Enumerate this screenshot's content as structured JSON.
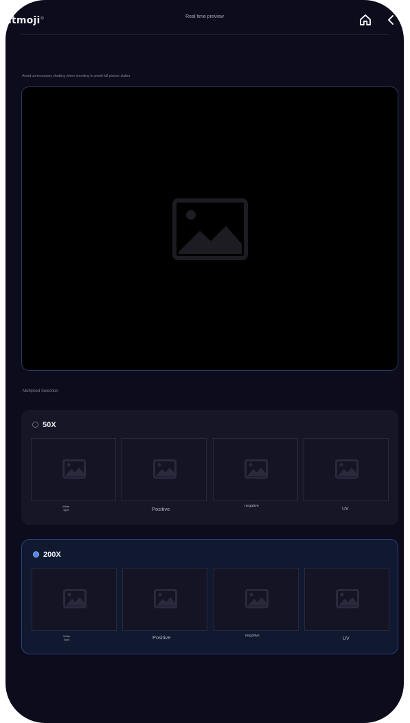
{
  "app": {
    "logo": "itmoji",
    "logo_mark": "®",
    "title": "Real time preview"
  },
  "preview": {
    "hint": "Avoid unnecessary shaking when shooting to avoid full picture clutter",
    "image_icon": "image-placeholder-icon"
  },
  "magnification": {
    "section_label": "Multiplied Selection",
    "options": [
      {
        "label": "50X",
        "selected": false,
        "modes": [
          "White\nlight",
          "Positive",
          "negative",
          "UV"
        ]
      },
      {
        "label": "200X",
        "selected": true,
        "modes": [
          "White\nlight",
          "Positive",
          "negative",
          "UV"
        ]
      }
    ]
  },
  "colors": {
    "background": "#0c0c1c",
    "card": "#161627",
    "card_selected_border": "#2a4480",
    "accent": "#4d86e6"
  }
}
